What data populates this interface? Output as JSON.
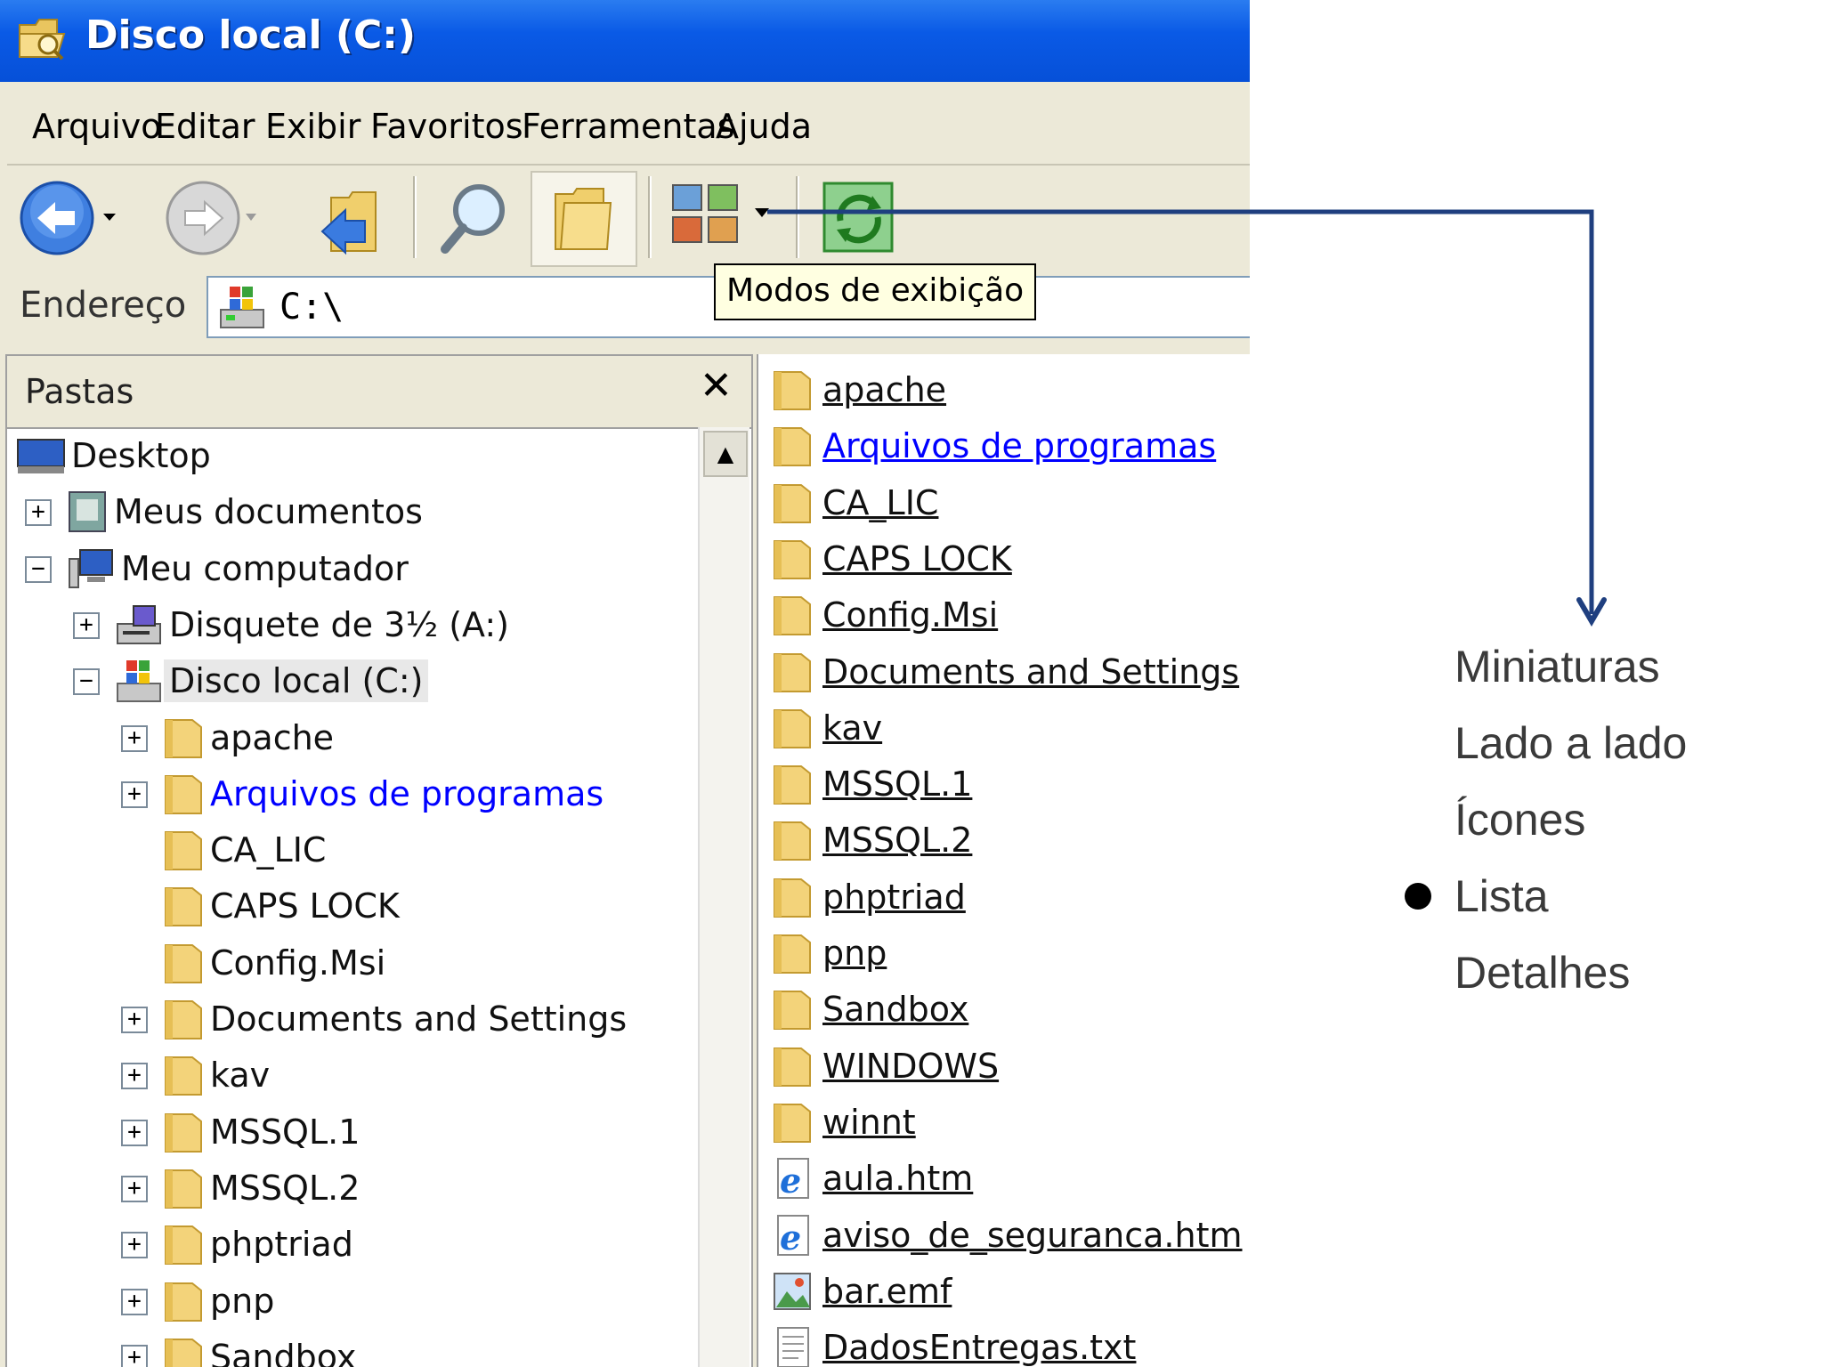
{
  "window": {
    "title": "Disco local (C:)"
  },
  "menu": [
    "Arquivo",
    "Editar",
    "Exibir",
    "Favoritos",
    "Ferramentas",
    "Ajuda"
  ],
  "toolbar": {
    "buttons": [
      "back-button",
      "forward-button",
      "up-button",
      "search-button",
      "folders-button",
      "views-button",
      "sync-button"
    ],
    "tooltip": "Modos de exibição"
  },
  "address": {
    "label": "Endereço",
    "value": "C:\\"
  },
  "folders_pane": {
    "title": "Pastas",
    "close": "✕",
    "tree": [
      {
        "label": "Desktop",
        "icon": "desktop-icon"
      },
      {
        "label": "Meus documentos",
        "icon": "my-documents-icon",
        "expander": "+"
      },
      {
        "label": "Meu computador",
        "icon": "my-computer-icon",
        "expander": "−"
      },
      {
        "label": "Disquete de 3½ (A:)",
        "icon": "floppy-drive-icon",
        "expander": "+"
      },
      {
        "label": "Disco local (C:)",
        "icon": "local-disk-icon",
        "expander": "−",
        "selected": true
      },
      {
        "label": "apache",
        "icon": "folder-icon",
        "expander": "+"
      },
      {
        "label": "Arquivos de programas",
        "icon": "folder-icon",
        "expander": "+",
        "link": true
      },
      {
        "label": "CA_LIC",
        "icon": "folder-icon"
      },
      {
        "label": "CAPS LOCK",
        "icon": "folder-icon"
      },
      {
        "label": "Config.Msi",
        "icon": "folder-icon"
      },
      {
        "label": "Documents and Settings",
        "icon": "folder-icon",
        "expander": "+"
      },
      {
        "label": "kav",
        "icon": "folder-icon",
        "expander": "+"
      },
      {
        "label": "MSSQL.1",
        "icon": "folder-icon",
        "expander": "+"
      },
      {
        "label": "MSSQL.2",
        "icon": "folder-icon",
        "expander": "+"
      },
      {
        "label": "phptriad",
        "icon": "folder-icon",
        "expander": "+"
      },
      {
        "label": "pnp",
        "icon": "folder-icon",
        "expander": "+"
      },
      {
        "label": "Sandbox",
        "icon": "folder-icon",
        "expander": "+"
      }
    ]
  },
  "file_list": [
    {
      "label": "apache",
      "icon": "folder-icon"
    },
    {
      "label": "Arquivos de programas",
      "icon": "folder-icon",
      "link": true
    },
    {
      "label": "CA_LIC",
      "icon": "folder-icon"
    },
    {
      "label": "CAPS LOCK",
      "icon": "folder-icon"
    },
    {
      "label": "Config.Msi",
      "icon": "folder-icon"
    },
    {
      "label": "Documents and Settings",
      "icon": "folder-icon"
    },
    {
      "label": "kav",
      "icon": "folder-icon"
    },
    {
      "label": "MSSQL.1",
      "icon": "folder-icon"
    },
    {
      "label": "MSSQL.2",
      "icon": "folder-icon"
    },
    {
      "label": "phptriad",
      "icon": "folder-icon"
    },
    {
      "label": "pnp",
      "icon": "folder-icon"
    },
    {
      "label": "Sandbox",
      "icon": "folder-icon"
    },
    {
      "label": "WINDOWS",
      "icon": "folder-icon"
    },
    {
      "label": "winnt",
      "icon": "folder-icon"
    },
    {
      "label": "aula.htm",
      "icon": "ie-document-icon"
    },
    {
      "label": "aviso_de_seguranca.htm",
      "icon": "ie-document-icon"
    },
    {
      "label": "bar.emf",
      "icon": "image-file-icon"
    },
    {
      "label": "DadosEntregas.txt",
      "icon": "text-file-icon"
    }
  ],
  "view_modes": {
    "items": [
      "Miniaturas",
      "Lado a lado",
      "Ícones",
      "Lista",
      "Detalhes"
    ],
    "selected": "Lista"
  },
  "colors": {
    "title_bar": "#0a5ae6",
    "link": "#0000ff",
    "callout_arrow": "#1f3f7f",
    "folder": "#f3d37a"
  }
}
